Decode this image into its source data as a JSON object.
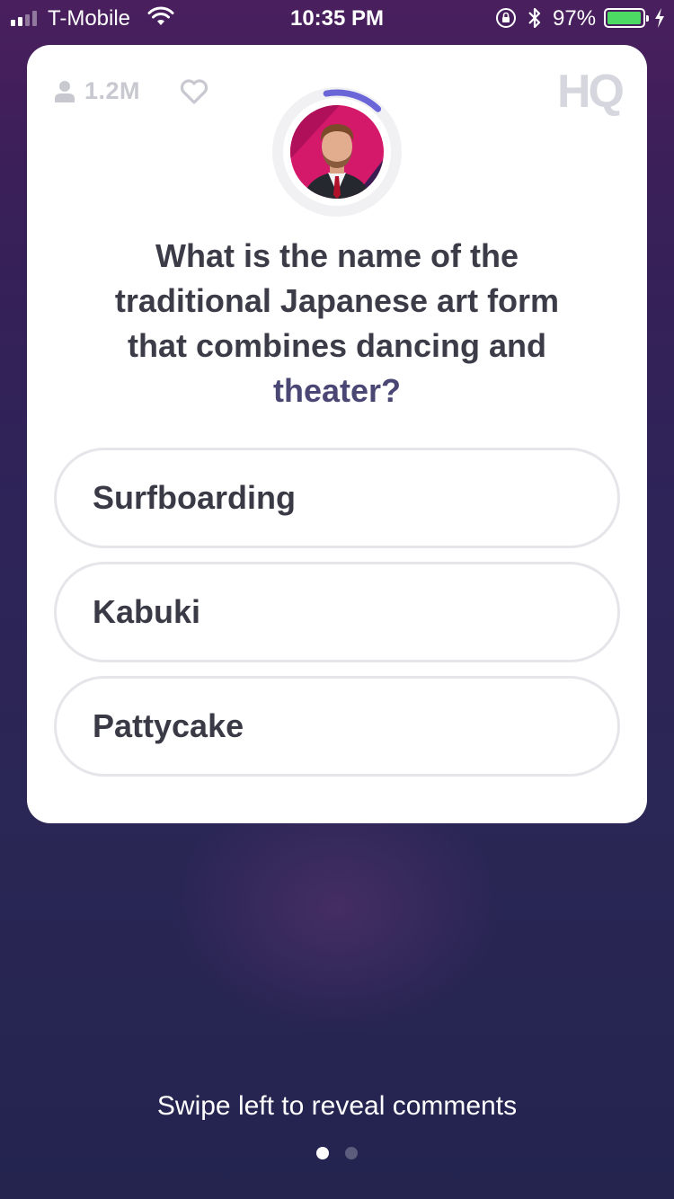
{
  "status_bar": {
    "carrier": "T-Mobile",
    "time": "10:35 PM",
    "battery_percent": "97%",
    "battery_level": 0.97,
    "icons": [
      "signal-icon",
      "wifi-icon",
      "rotation-lock-icon",
      "bluetooth-icon",
      "battery-icon",
      "charging-icon"
    ]
  },
  "header": {
    "viewer_count": "1.2M",
    "logo": "HQ",
    "timer_progress": 0.15
  },
  "question": {
    "line1": "What is the name of the",
    "line2": "traditional Japanese art form",
    "line3": "that combines dancing and",
    "line4": "theater?"
  },
  "answers": [
    {
      "label": "Surfboarding"
    },
    {
      "label": "Kabuki"
    },
    {
      "label": "Pattycake"
    }
  ],
  "footer": {
    "hint": "Swipe left to reveal comments",
    "page_dots": 2,
    "active_page": 1
  },
  "colors": {
    "timer_ring": "#6a66d8",
    "battery_fill": "#4cd964",
    "question_highlight": "#4a4775",
    "card_bg": "#ffffff"
  }
}
